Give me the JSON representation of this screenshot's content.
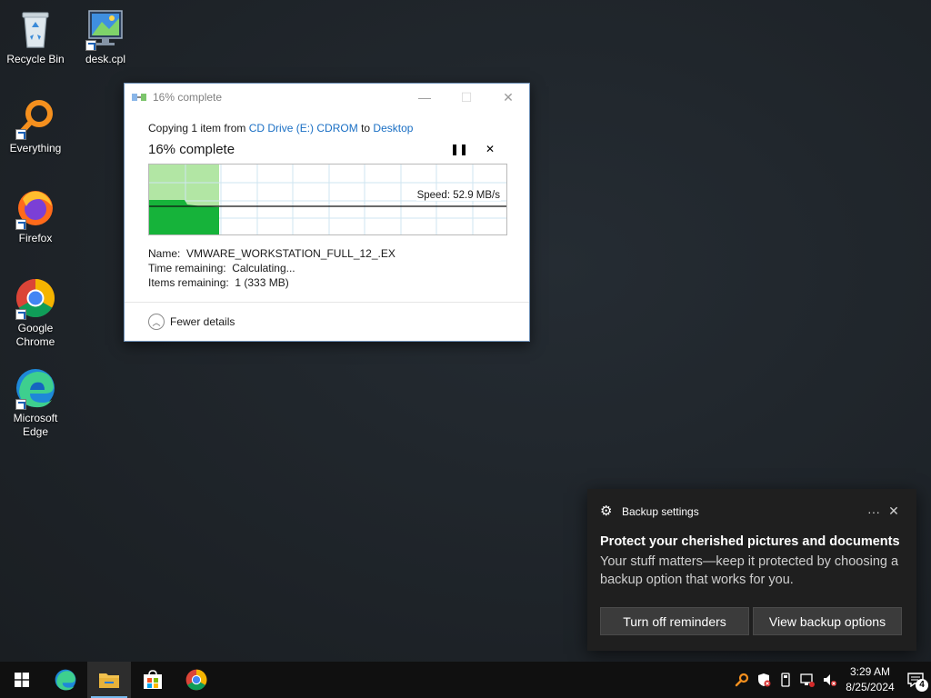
{
  "desktop": {
    "icons": [
      {
        "label": "Recycle Bin",
        "icon": "recycle-bin-icon"
      },
      {
        "label": "desk.cpl",
        "icon": "display-settings-icon"
      },
      {
        "label": "Everything",
        "icon": "everything-search-icon"
      },
      {
        "label": "Firefox",
        "icon": "firefox-icon"
      },
      {
        "label": "Google Chrome",
        "icon": "chrome-icon"
      },
      {
        "label": "Microsoft Edge",
        "icon": "edge-icon"
      }
    ]
  },
  "copy_dialog": {
    "title": "16% complete",
    "copy_prefix": "Copying 1 item from",
    "source": "CD Drive (E:) CDROM",
    "to_word": "to",
    "destination": "Desktop",
    "percent_label": "16% complete",
    "progress": 0.16,
    "speed": "Speed: 52.9 MB/s",
    "name_label": "Name:",
    "name_value": "VMWARE_WORKSTATION_FULL_12_.EX",
    "time_label": "Time remaining:",
    "time_value": "Calculating...",
    "items_label": "Items remaining:",
    "items_value": "1 (333 MB)",
    "fewer_details": "Fewer details",
    "pause_symbol": "❚❚",
    "cancel_symbol": "✕",
    "colors": {
      "fill_light": "#b2e6a4",
      "fill_dark": "#16b33a",
      "link": "#1a6fc4"
    }
  },
  "toast": {
    "source": "Backup settings",
    "title": "Protect your cherished pictures and documents",
    "message": "Your stuff matters—keep it protected by choosing a backup option that works for you.",
    "button_1": "Turn off reminders",
    "button_2": "View backup options",
    "more_symbol": "···",
    "close_symbol": "✕"
  },
  "taskbar": {
    "apps": [
      "start-icon",
      "edge-icon",
      "file-explorer-icon",
      "store-icon",
      "chrome-icon"
    ],
    "time": "3:29 AM",
    "date": "8/25/2024",
    "notification_count": "4"
  }
}
